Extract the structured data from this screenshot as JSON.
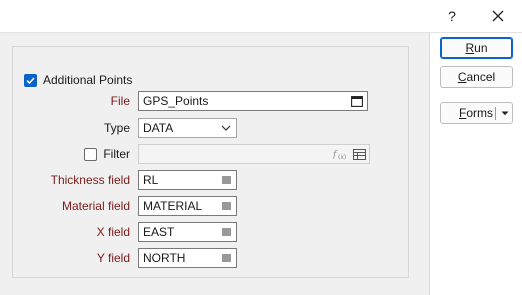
{
  "titlebar": {
    "help_label": "?",
    "close_icon": "close-icon"
  },
  "group": {
    "label": "Additional Points",
    "checked": true
  },
  "fields": {
    "file": {
      "label": "File",
      "value": "GPS_Points",
      "icon": "window-icon"
    },
    "type": {
      "label": "Type",
      "value": "DATA",
      "icon": "chevron-down-icon"
    },
    "filter": {
      "label": "Filter",
      "value": "",
      "checked": false,
      "icons": [
        "fx-icon",
        "table-icon"
      ]
    },
    "thickness": {
      "label": "Thickness field",
      "value": "RL",
      "icon": "list-icon"
    },
    "material": {
      "label": "Material field",
      "value": "MATERIAL",
      "icon": "list-icon"
    },
    "x": {
      "label": "X field",
      "value": "EAST",
      "icon": "list-icon"
    },
    "y": {
      "label": "Y field",
      "value": "NORTH",
      "icon": "list-icon"
    }
  },
  "buttons": {
    "run": {
      "first": "R",
      "rest": "un"
    },
    "cancel": {
      "first": "C",
      "rest": "ancel"
    },
    "forms": {
      "first": "F",
      "rest": "orms"
    }
  },
  "colors": {
    "required_label": "#7b1a1a",
    "accent": "#0a63c9",
    "panel": "#f0f0f0"
  }
}
